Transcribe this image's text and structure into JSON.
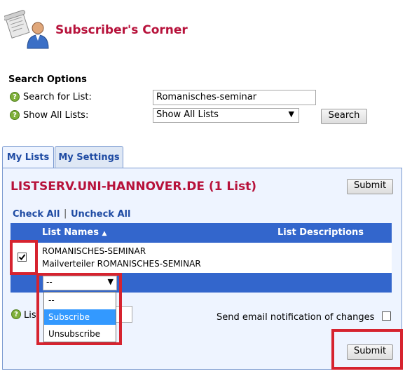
{
  "header": {
    "title": "Subscriber's Corner"
  },
  "search_options": {
    "heading": "Search Options",
    "search_label": "Search for List:",
    "search_value": "Romanisches-seminar",
    "show_label": "Show All Lists:",
    "show_value": "Show All Lists",
    "search_button": "Search"
  },
  "tabs": [
    {
      "label": "My Lists",
      "active": true
    },
    {
      "label": "My Settings",
      "active": false
    }
  ],
  "panel": {
    "server_title": "LISTSERV.UNI-HANNOVER.DE (1 List)",
    "submit_top": "Submit",
    "check_all": "Check All",
    "separator": "|",
    "uncheck_all": "Uncheck All",
    "col_names": "List Names",
    "sort_indicator": "▲",
    "col_descriptions": "List Descriptions",
    "list_row": {
      "name": "ROMANISCHES-SEMINAR",
      "description": "Mailverteiler ROMANISCHES-SEMINAR",
      "checked": true
    },
    "action_select": {
      "value": "--",
      "options": [
        "--",
        "Subscribe",
        "Unsubscribe"
      ],
      "highlighted": "Subscribe"
    },
    "list_field_label_partial": "Lis",
    "notify_label": "Send email notification of changes",
    "submit_bottom": "Submit"
  },
  "colors": {
    "brand_red": "#b7123b",
    "header_blue": "#3366cc",
    "highlight": "#d6232f"
  },
  "icons": {
    "logo": "subscriber-person-icon",
    "help": "question-icon",
    "dropdown": "chevron-down-icon"
  }
}
